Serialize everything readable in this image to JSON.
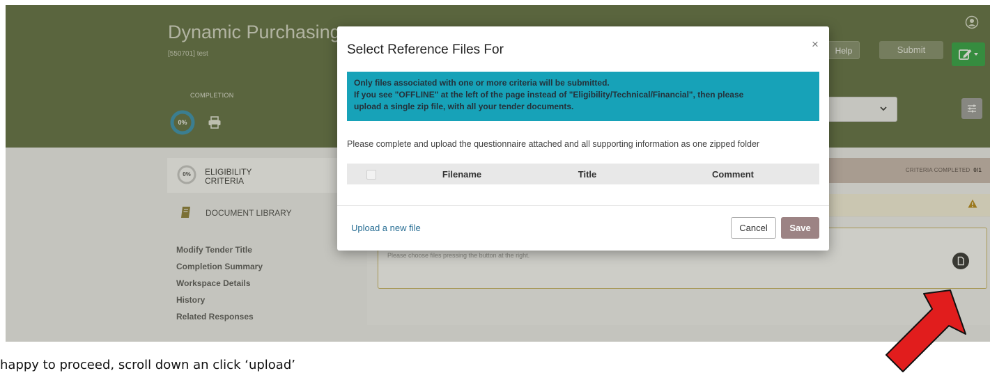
{
  "app": {
    "title": "Dynamic Purchasing",
    "reference": "[550701] test",
    "completion_label": "COMPLETION",
    "completion_percent": "0%"
  },
  "header": {
    "help_label": "Help",
    "submit_label": "Submit"
  },
  "sidebar": {
    "eligibility": {
      "percent": "0%",
      "label": "ELIGIBILITY CRITERIA"
    },
    "doc_library_label": "DOCUMENT LIBRARY",
    "links": [
      "Modify Tender Title",
      "Completion Summary",
      "Workspace Details",
      "History",
      "Related Responses"
    ]
  },
  "content": {
    "criteria_completed_label": "CRITERIA COMPLETED",
    "criteria_completed_value": "0/1",
    "choose_hint": "Please choose files pressing the button at the right."
  },
  "modal": {
    "title": "Select Reference Files For",
    "close_symbol": "×",
    "alert_lines": [
      "Only files associated with one or more criteria will be submitted.",
      "If you see \"OFFLINE\" at the left of the page instead of \"Eligibility/Technical/Financial\", then please",
      "upload a single zip file, with all your tender documents."
    ],
    "instruction": "Please complete and upload the questionnaire attached and all supporting information as one zipped folder",
    "table_headers": [
      "Filename",
      "Title",
      "Comment"
    ],
    "upload_link": "Upload a new file",
    "cancel_label": "Cancel",
    "save_label": "Save"
  },
  "caption": "happy to proceed, scroll down an click ‘upload’",
  "colors": {
    "header": "#5b6b3c",
    "alert": "#17a2b8",
    "save": "#9c8384",
    "edit": "#28a33d",
    "arrow": "#e11d1d"
  }
}
